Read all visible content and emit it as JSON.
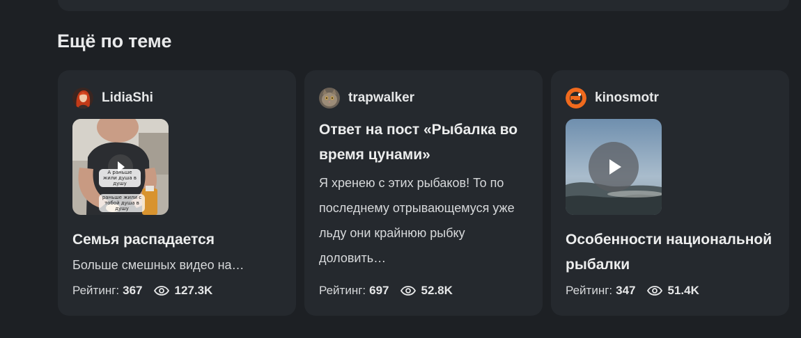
{
  "section": {
    "title": "Ещё по теме"
  },
  "cards": [
    {
      "author": "LidiaShi",
      "avatar_icon": "avatar-redhead-icon",
      "thumb_caption_1": "А раньше жили душа в душу",
      "thumb_caption_2": "раньше жили с тобой душа в душу",
      "title": "Семья распадается",
      "description": "Больше смешных видео на…",
      "rating_label": "Рейтинг:",
      "rating": "367",
      "views": "127.3K"
    },
    {
      "author": "trapwalker",
      "avatar_icon": "avatar-cat-icon",
      "title": "Ответ на пост «Рыбалка во время цунами»",
      "description": "Я хренею с этих рыбаков! То по последнему отрывающемуся уже льду они крайнюю рыбку доловить…",
      "rating_label": "Рейтинг:",
      "rating": "697",
      "views": "52.8K"
    },
    {
      "author": "kinosmotr",
      "avatar_icon": "avatar-kino-icon",
      "title": "Особенности национальной рыбалки",
      "rating_label": "Рейтинг:",
      "rating": "347",
      "views": "51.4K"
    }
  ],
  "colors": {
    "background": "#1d2024",
    "card": "#25292e",
    "text": "#e6e7e8",
    "accent_orange": "#f06a1d"
  }
}
